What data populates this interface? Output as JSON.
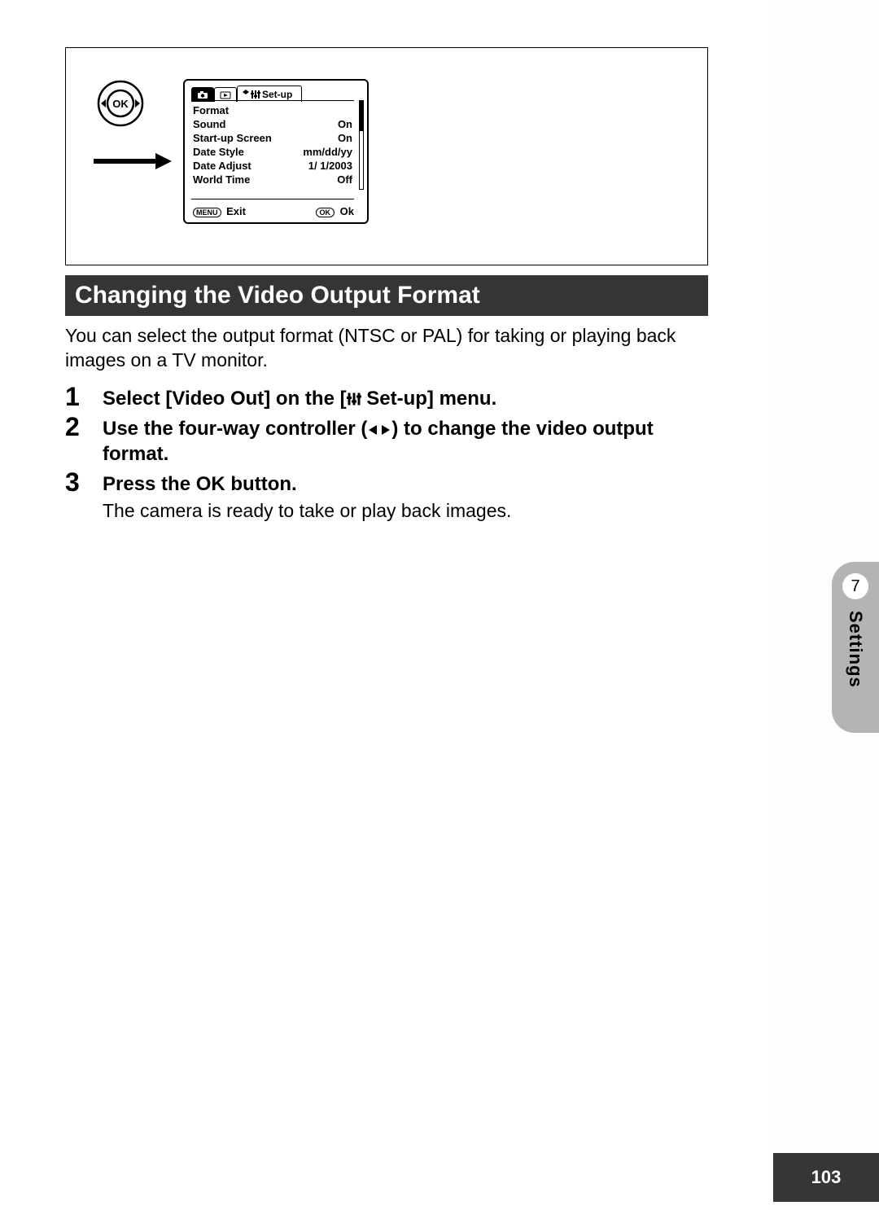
{
  "lcd": {
    "tab_setup_label": "Set-up",
    "rows": [
      {
        "label": "Format",
        "value": ""
      },
      {
        "label": "Sound",
        "value": "On"
      },
      {
        "label": "Start-up Screen",
        "value": "On"
      },
      {
        "label": "Date Style",
        "value": "mm/dd/yy"
      },
      {
        "label": "Date Adjust",
        "value": "1/ 1/2003"
      },
      {
        "label": "World Time",
        "value": "Off"
      }
    ],
    "footer_menu_badge": "MENU",
    "footer_exit": "Exit",
    "footer_ok_badge": "OK",
    "footer_ok": "Ok"
  },
  "heading": "Changing the Video Output Format",
  "intro": "You can select the output format (NTSC or PAL) for taking or playing back images on a TV monitor.",
  "steps": [
    {
      "num": "1",
      "title_before": "Select [Video Out] on the [",
      "title_after": " Set-up] menu.",
      "desc": ""
    },
    {
      "num": "2",
      "title_before": "Use the four-way controller (",
      "title_after": ") to change the video output format.",
      "desc": ""
    },
    {
      "num": "3",
      "title_before": "Press the OK button.",
      "title_after": "",
      "desc": "The camera is ready to take or play back images."
    }
  ],
  "side": {
    "chapter_num": "7",
    "chapter_label": "Settings"
  },
  "page_number": "103"
}
